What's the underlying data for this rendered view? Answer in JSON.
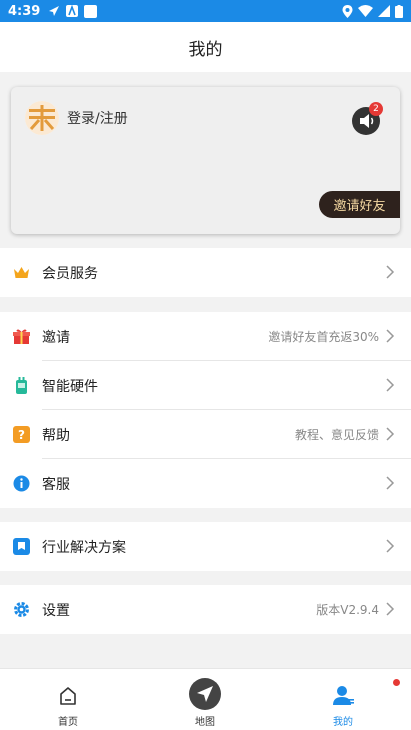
{
  "status_bar": {
    "time": "4:39"
  },
  "header": {
    "title": "我的"
  },
  "profile": {
    "login_label": "登录/注册",
    "notification_count": "2",
    "invite_button_label": "邀请好友"
  },
  "menu": {
    "membership": {
      "label": "会员服务"
    },
    "invite": {
      "label": "邀请",
      "value": "邀请好友首充返30%"
    },
    "smart_hardware": {
      "label": "智能硬件"
    },
    "help": {
      "label": "帮助",
      "value": "教程、意见反馈"
    },
    "customer_service": {
      "label": "客服"
    },
    "industry_solutions": {
      "label": "行业解决方案"
    },
    "settings": {
      "label": "设置",
      "value": "版本V2.9.4"
    }
  },
  "bottom_nav": {
    "home": "首页",
    "map": "地图",
    "mine": "我的"
  },
  "colors": {
    "accent": "#1b8ae6",
    "invite_button_bg": "#2e221d",
    "invite_button_text": "#f3d7a1",
    "badge_red": "#e53935"
  }
}
